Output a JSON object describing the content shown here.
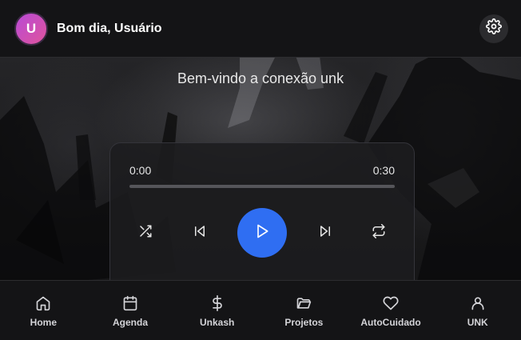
{
  "header": {
    "avatar_initial": "U",
    "greeting": "Bom dia, Usuário",
    "settings_icon": "gear-icon"
  },
  "welcome": {
    "title": "Bem-vindo a conexão unk"
  },
  "player": {
    "current_time": "0:00",
    "duration": "0:30",
    "progress_fraction": 0,
    "accent_color": "#2f6ef2",
    "controls": [
      {
        "name": "shuffle",
        "icon": "shuffle-icon"
      },
      {
        "name": "previous",
        "icon": "skip-back-icon"
      },
      {
        "name": "play",
        "icon": "play-icon"
      },
      {
        "name": "next",
        "icon": "skip-forward-icon"
      },
      {
        "name": "repeat",
        "icon": "repeat-icon"
      }
    ]
  },
  "nav": {
    "items": [
      {
        "label": "Home",
        "icon": "home-icon"
      },
      {
        "label": "Agenda",
        "icon": "calendar-icon"
      },
      {
        "label": "Unkash",
        "icon": "dollar-icon"
      },
      {
        "label": "Projetos",
        "icon": "folder-icon"
      },
      {
        "label": "AutoCuidado",
        "icon": "heart-icon"
      },
      {
        "label": "UNK",
        "icon": "user-icon"
      }
    ]
  }
}
